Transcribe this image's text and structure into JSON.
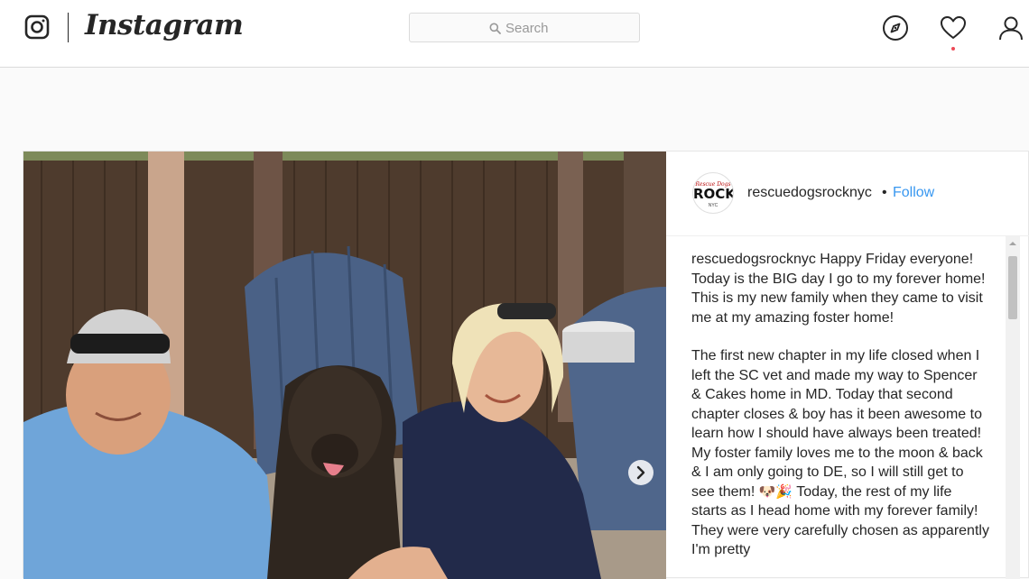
{
  "header": {
    "wordmark": "Instagram",
    "search_placeholder": "Search",
    "icons": [
      "instagram-logo-icon",
      "search-icon",
      "compass-icon",
      "heart-icon",
      "profile-icon"
    ],
    "notification_dot_color": "#ed4956"
  },
  "post": {
    "avatar": {
      "top_text": "Rescue Dogs",
      "main_text": "ROCK",
      "bottom_text": "NYC"
    },
    "username": "rescuedogsrocknyc",
    "separator": "•",
    "follow_label": "Follow",
    "follow_color": "#3897f0",
    "caption": {
      "username": "rescuedogsrocknyc",
      "paragraph1": " Happy Friday everyone! Today is the BIG day I go to my forever home! This is my new family when they came to visit me at my amazing foster home!",
      "paragraph2_a": "The first new chapter in my life closed when I left the SC vet and made my way to Spencer & Cakes home in MD. Today that second chapter closes & boy has it been awesome to learn how I should have always been treated! My foster family loves me to the moon & back & I am only going to DE, so I will still get to see them! ",
      "emojis": "🐶🎉",
      "paragraph2_b": " Today, the rest of my life starts as I head home with my forever family! They were very carefully chosen as apparently I'm pretty"
    },
    "next_button_icon": "chevron-right-icon"
  }
}
